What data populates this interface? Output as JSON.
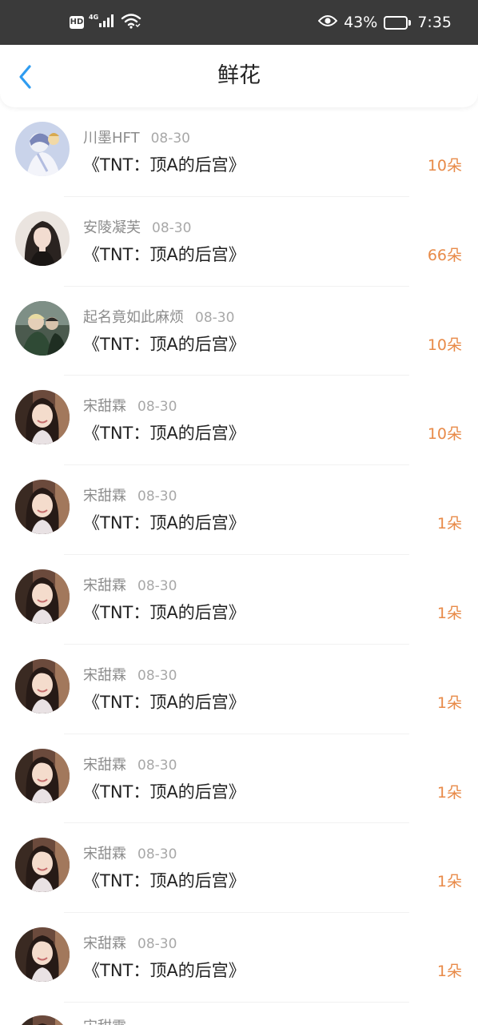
{
  "status_bar": {
    "hd": "HD",
    "network": "4G",
    "battery": "43%",
    "battery_level": 0.43,
    "time": "7:35",
    "icons": [
      "signal-icon",
      "wifi-icon",
      "eye-icon",
      "battery-icon"
    ]
  },
  "header": {
    "title": "鲜花",
    "back_icon": "chevron-left-icon",
    "accent_color": "#2f9cf0"
  },
  "flower_color": "#e88a48",
  "items": [
    {
      "name": "川墨HFT",
      "date": "08-30",
      "book": "《TNT：顶A的后宫》",
      "count": "10朵",
      "avatar": "anime"
    },
    {
      "name": "安陵凝芙",
      "date": "08-30",
      "book": "《TNT：顶A的后宫》",
      "count": "66朵",
      "avatar": "girl-dark"
    },
    {
      "name": "起名竟如此麻烦",
      "date": "08-30",
      "book": "《TNT：顶A的后宫》",
      "count": "10朵",
      "avatar": "group"
    },
    {
      "name": "宋甜霖",
      "date": "08-30",
      "book": "《TNT：顶A的后宫》",
      "count": "10朵",
      "avatar": "girl"
    },
    {
      "name": "宋甜霖",
      "date": "08-30",
      "book": "《TNT：顶A的后宫》",
      "count": "1朵",
      "avatar": "girl"
    },
    {
      "name": "宋甜霖",
      "date": "08-30",
      "book": "《TNT：顶A的后宫》",
      "count": "1朵",
      "avatar": "girl"
    },
    {
      "name": "宋甜霖",
      "date": "08-30",
      "book": "《TNT：顶A的后宫》",
      "count": "1朵",
      "avatar": "girl"
    },
    {
      "name": "宋甜霖",
      "date": "08-30",
      "book": "《TNT：顶A的后宫》",
      "count": "1朵",
      "avatar": "girl"
    },
    {
      "name": "宋甜霖",
      "date": "08-30",
      "book": "《TNT：顶A的后宫》",
      "count": "1朵",
      "avatar": "girl"
    },
    {
      "name": "宋甜霖",
      "date": "08-30",
      "book": "《TNT：顶A的后宫》",
      "count": "1朵",
      "avatar": "girl"
    }
  ],
  "partial_item": {
    "name": "宋甜霖",
    "avatar": "girl"
  }
}
